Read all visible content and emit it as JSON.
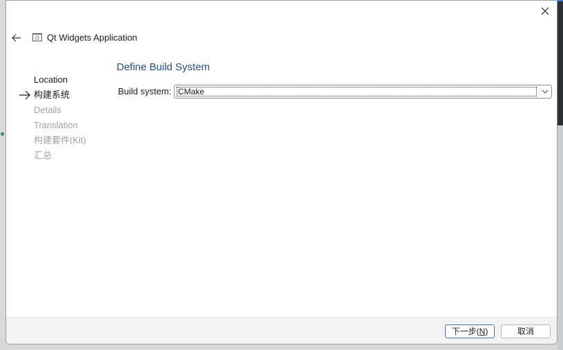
{
  "window": {
    "close_icon": "close-icon"
  },
  "header": {
    "back_icon": "arrow-left-icon",
    "app_icon": "window-icon",
    "title": "Qt Widgets Application"
  },
  "steps": [
    {
      "label": "Location",
      "state": "done"
    },
    {
      "label": "构建系统",
      "state": "current"
    },
    {
      "label": "Details",
      "state": "pending"
    },
    {
      "label": "Translation",
      "state": "pending"
    },
    {
      "label": "构建套件(Kit)",
      "state": "pending"
    },
    {
      "label": "汇总",
      "state": "pending"
    }
  ],
  "page": {
    "title": "Define Build System",
    "build_system_label": "Build system:",
    "build_system_value": "CMake"
  },
  "footer": {
    "next_prefix": "下一步(",
    "next_mnemonic": "N",
    "next_suffix": ")",
    "cancel_label": "取消"
  },
  "colors": {
    "title_blue": "#1f4e8c",
    "pending_gray": "#a0a0a0",
    "primary_border": "#3a73c4"
  }
}
